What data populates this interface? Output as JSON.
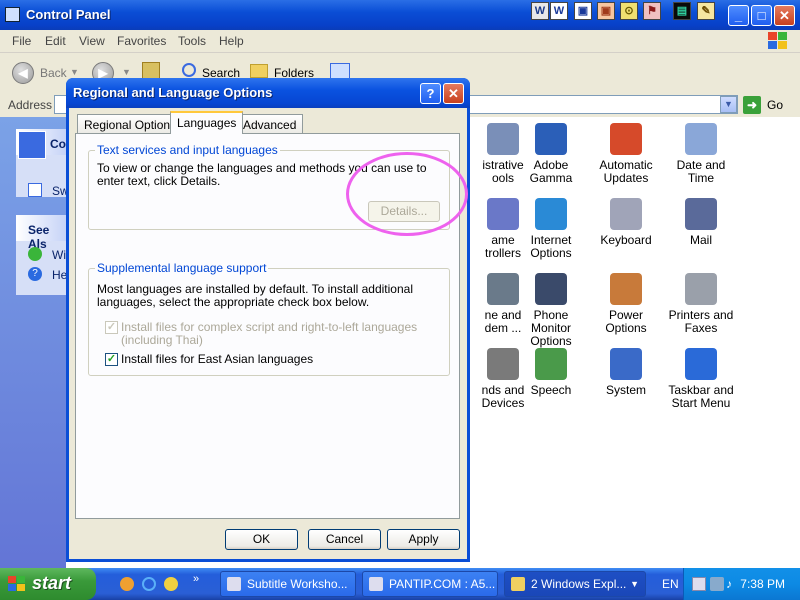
{
  "window": {
    "title": "Control Panel",
    "minimize": "_",
    "maximize": "□",
    "close": "✕"
  },
  "top_tray_icons": [
    "W",
    "W",
    "▣",
    "▣",
    "⊙",
    "⚑",
    "▤",
    "✎"
  ],
  "menu": [
    "File",
    "Edit",
    "View",
    "Favorites",
    "Tools",
    "Help"
  ],
  "toolbar": {
    "back_label": "Back",
    "search_label": "Search",
    "folders_label": "Folders"
  },
  "address": {
    "label": "Address",
    "go_label": "Go"
  },
  "left_panel": {
    "box1_title": "Con",
    "box1_link": "Sw",
    "box2_title": "See Als",
    "box2_link1": "Wi",
    "box2_link2": "He"
  },
  "control_panel_items": [
    {
      "label": "istrative\nools",
      "icon": "admin-tools-icon",
      "color": "#7a8fb8"
    },
    {
      "label": "Adobe Gamma",
      "icon": "monitor-icon",
      "color": "#2b5fb8"
    },
    {
      "label": "Automatic\nUpdates",
      "icon": "windows-flag-icon",
      "color": "#d64a2a"
    },
    {
      "label": "Date and Time",
      "icon": "clock-icon",
      "color": "#8aa7d8"
    },
    {
      "label": "ame\ntrollers",
      "icon": "game-controller-icon",
      "color": "#6a78c8"
    },
    {
      "label": "Internet\nOptions",
      "icon": "globe-icon",
      "color": "#2a8ad6"
    },
    {
      "label": "Keyboard",
      "icon": "keyboard-icon",
      "color": "#a0a4b8"
    },
    {
      "label": "Mail",
      "icon": "mail-icon",
      "color": "#5a6a9a"
    },
    {
      "label": "ne and\ndem ...",
      "icon": "modem-icon",
      "color": "#6a7a8a"
    },
    {
      "label": "Phone Monitor\nOptions",
      "icon": "phone-icon",
      "color": "#3a4a6a"
    },
    {
      "label": "Power Options",
      "icon": "power-icon",
      "color": "#c87a3a"
    },
    {
      "label": "Printers and\nFaxes",
      "icon": "printer-icon",
      "color": "#9aa0aa"
    },
    {
      "label": "nds and\n Devices",
      "icon": "speaker-icon",
      "color": "#7a7a7a"
    },
    {
      "label": "Speech",
      "icon": "speech-icon",
      "color": "#4a9a4a"
    },
    {
      "label": "System",
      "icon": "system-icon",
      "color": "#3a6ac8"
    },
    {
      "label": "Taskbar and\nStart Menu",
      "icon": "taskbar-icon",
      "color": "#2a6ad8"
    }
  ],
  "dialog": {
    "title": "Regional and Language Options",
    "help": "?",
    "close": "✕",
    "tabs": [
      "Regional Options",
      "Languages",
      "Advanced"
    ],
    "active_tab": "Languages",
    "group1": {
      "title": "Text services and input languages",
      "description": "To view or change the languages and methods you can use to enter text, click Details.",
      "details_button": "Details..."
    },
    "group2": {
      "title": "Supplemental language support",
      "description": "Most languages are installed by default. To install additional languages, select the appropriate check box below.",
      "checkbox1": {
        "label": "Install files for complex script and right-to-left languages (including Thai)",
        "checked": true,
        "disabled": true
      },
      "checkbox2": {
        "label": "Install files for East Asian languages",
        "checked": true,
        "disabled": false
      }
    },
    "ok": "OK",
    "cancel": "Cancel",
    "apply": "Apply"
  },
  "taskbar": {
    "start_label": "start",
    "tasks": [
      {
        "label": "Subtitle Worksho..."
      },
      {
        "label": "PANTIP.COM : A5..."
      },
      {
        "label": "2 Windows Expl..."
      }
    ],
    "language": "EN",
    "clock": "7:38 PM"
  },
  "colors": {
    "title_blue": "#0a4ed6",
    "start_green": "#3a9a3a",
    "highlight_circle": "#ee62ee",
    "group_title": "#0046d5"
  }
}
